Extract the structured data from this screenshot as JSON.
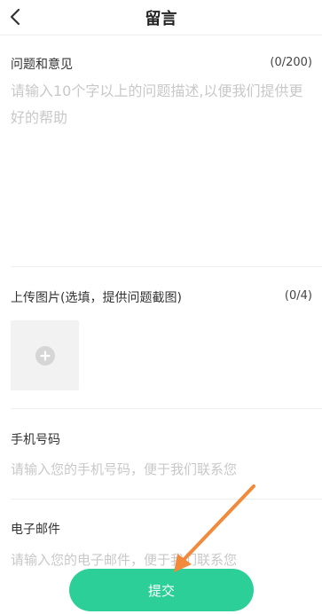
{
  "header": {
    "title": "留言",
    "back_icon": "chevron-left-icon"
  },
  "feedback": {
    "label": "问题和意见",
    "counter": "(0/200)",
    "placeholder": "请输入10个字以上的问题描述,以便我们提供更好的帮助"
  },
  "upload": {
    "label": "上传图片(选填，提供问题截图)",
    "counter": "(0/4)",
    "add_icon": "plus-circle-icon"
  },
  "phone": {
    "label": "手机号码",
    "placeholder": "请输入您的手机号码，便于我们联系您"
  },
  "email": {
    "label": "电子邮件",
    "placeholder": "请输入您的电子邮件，便于我们联系您"
  },
  "submit": {
    "label": "提交"
  },
  "colors": {
    "accent": "#2ccf97",
    "annotation_arrow": "#f28a3c",
    "placeholder": "#c8c8c8"
  }
}
